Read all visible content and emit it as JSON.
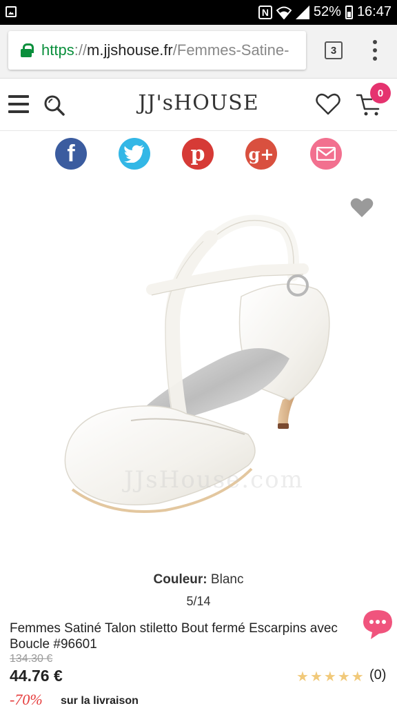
{
  "status_bar": {
    "nfc_label": "N",
    "battery": "52%",
    "time": "16:47"
  },
  "browser": {
    "url_scheme": "https",
    "url_sep": "://",
    "url_host": "m.jjshouse.fr",
    "url_path": "/Femmes-Satine-",
    "tab_count": "3"
  },
  "header": {
    "logo": "JJ'sHOUSE",
    "cart_count": "0"
  },
  "social": {
    "facebook_glyph": "f",
    "pinterest_glyph": "p",
    "googleplus_glyph": "g+"
  },
  "product": {
    "watermark": "JJsHouse.com",
    "color_label": "Couleur:",
    "color_value": " Blanc",
    "pager": "5/14",
    "title": "Femmes Satiné Talon stiletto Bout fermé Escarpins avec Boucle #96601",
    "old_price": "134.30 €",
    "price": "44.76 €",
    "rating_stars": 5,
    "rating_count": "(0)",
    "discount": "-70%",
    "shipping": "sur la livraison"
  },
  "colors": {
    "brand_pink": "#e5336f",
    "secure_green": "#0a8f3c",
    "discount_red": "#e53c3c",
    "star": "#f1c97a"
  }
}
